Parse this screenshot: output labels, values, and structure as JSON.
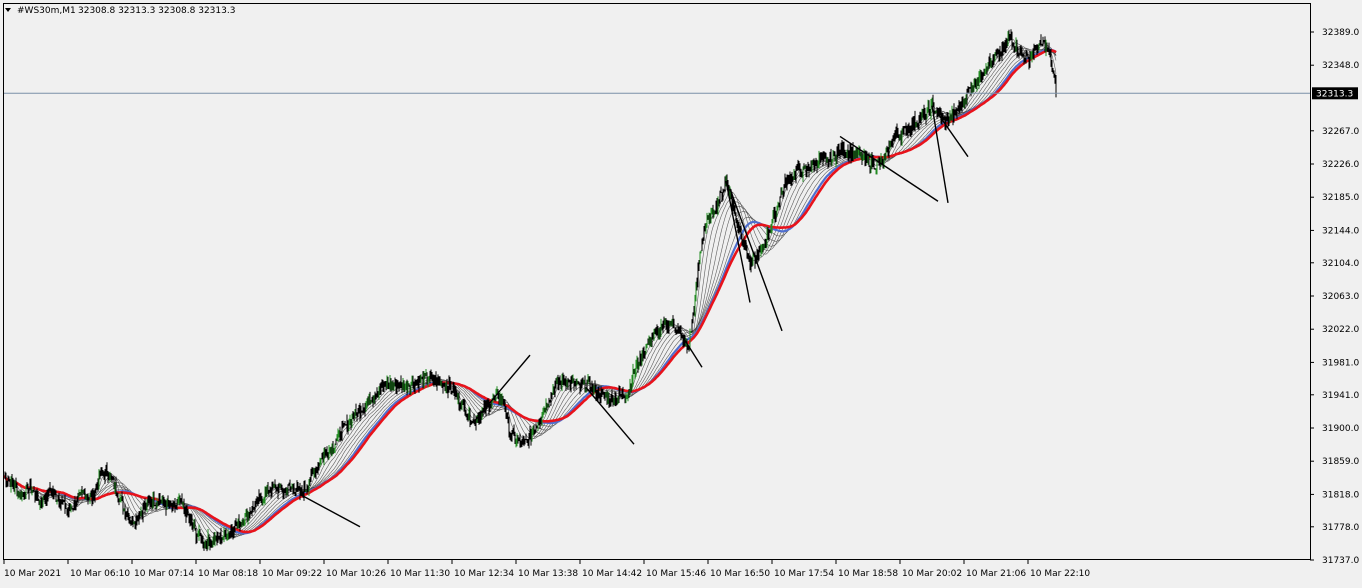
{
  "header": {
    "symbol": "#WS30m,M1",
    "ohlc": "32308.8 32313.3 32308.8 32313.3"
  },
  "colors": {
    "background": "#f0f0f0",
    "price": "#000000",
    "bull_candle": "#228b22",
    "ribbon": "#444444",
    "ma_blue": "#4f6fcf",
    "ma_red": "#e8131b",
    "price_line": "#7a90a8",
    "label_bg": "#000000",
    "label_text": "#ffffff"
  },
  "chart_data": {
    "type": "line",
    "title": "#WS30m,M1",
    "grid": false,
    "current_price": 32313.3,
    "current_price_label": "32313.3",
    "y_ticks": [
      "32389.0",
      "32348.0",
      "32307.0",
      "32267.0",
      "32226.0",
      "32185.0",
      "32144.0",
      "32104.0",
      "32063.0",
      "32022.0",
      "31981.0",
      "31941.0",
      "31900.0",
      "31859.0",
      "31818.0",
      "31778.0",
      "31737.0"
    ],
    "y_tick_values": [
      32389.0,
      32348.0,
      32307.0,
      32267.0,
      32226.0,
      32185.0,
      32144.0,
      32104.0,
      32063.0,
      32022.0,
      31981.0,
      31941.0,
      31900.0,
      31859.0,
      31818.0,
      31778.0,
      31737.0
    ],
    "ylim": [
      31737.0,
      32389.0
    ],
    "x_ticks": [
      "10 Mar 2021",
      "10 Mar 06:10",
      "10 Mar 07:14",
      "10 Mar 08:18",
      "10 Mar 09:22",
      "10 Mar 10:26",
      "10 Mar 11:30",
      "10 Mar 12:34",
      "10 Mar 13:38",
      "10 Mar 14:42",
      "10 Mar 15:46",
      "10 Mar 16:50",
      "10 Mar 17:54",
      "10 Mar 18:58",
      "10 Mar 20:02",
      "10 Mar 21:06",
      "10 Mar 22:10"
    ],
    "price_path": [
      [
        0,
        31840
      ],
      [
        8,
        31832
      ],
      [
        18,
        31815
      ],
      [
        26,
        31828
      ],
      [
        36,
        31808
      ],
      [
        46,
        31822
      ],
      [
        56,
        31812
      ],
      [
        64,
        31798
      ],
      [
        72,
        31808
      ],
      [
        80,
        31820
      ],
      [
        88,
        31812
      ],
      [
        96,
        31842
      ],
      [
        104,
        31845
      ],
      [
        112,
        31825
      ],
      [
        120,
        31800
      ],
      [
        128,
        31785
      ],
      [
        136,
        31795
      ],
      [
        146,
        31810
      ],
      [
        156,
        31812
      ],
      [
        166,
        31800
      ],
      [
        176,
        31808
      ],
      [
        184,
        31790
      ],
      [
        192,
        31770
      ],
      [
        200,
        31760
      ],
      [
        208,
        31762
      ],
      [
        216,
        31765
      ],
      [
        224,
        31770
      ],
      [
        232,
        31780
      ],
      [
        240,
        31790
      ],
      [
        248,
        31800
      ],
      [
        256,
        31812
      ],
      [
        264,
        31822
      ],
      [
        272,
        31826
      ],
      [
        280,
        31822
      ],
      [
        288,
        31828
      ],
      [
        296,
        31818
      ],
      [
        304,
        31830
      ],
      [
        312,
        31852
      ],
      [
        320,
        31868
      ],
      [
        328,
        31876
      ],
      [
        336,
        31894
      ],
      [
        344,
        31905
      ],
      [
        352,
        31918
      ],
      [
        360,
        31928
      ],
      [
        368,
        31938
      ],
      [
        376,
        31950
      ],
      [
        384,
        31954
      ],
      [
        392,
        31955
      ],
      [
        400,
        31952
      ],
      [
        408,
        31956
      ],
      [
        416,
        31958
      ],
      [
        424,
        31962
      ],
      [
        432,
        31958
      ],
      [
        440,
        31955
      ],
      [
        448,
        31948
      ],
      [
        456,
        31932
      ],
      [
        464,
        31918
      ],
      [
        470,
        31908
      ],
      [
        478,
        31918
      ],
      [
        486,
        31930
      ],
      [
        494,
        31940
      ],
      [
        500,
        31930
      ],
      [
        506,
        31895
      ],
      [
        512,
        31885
      ],
      [
        518,
        31880
      ],
      [
        524,
        31885
      ],
      [
        530,
        31898
      ],
      [
        536,
        31912
      ],
      [
        542,
        31928
      ],
      [
        548,
        31945
      ],
      [
        554,
        31955
      ],
      [
        560,
        31960
      ],
      [
        568,
        31955
      ],
      [
        576,
        31950
      ],
      [
        584,
        31955
      ],
      [
        592,
        31945
      ],
      [
        600,
        31938
      ],
      [
        608,
        31935
      ],
      [
        616,
        31940
      ],
      [
        624,
        31945
      ],
      [
        630,
        31970
      ],
      [
        636,
        31985
      ],
      [
        642,
        32000
      ],
      [
        648,
        32012
      ],
      [
        654,
        32018
      ],
      [
        660,
        32025
      ],
      [
        666,
        32030
      ],
      [
        672,
        32025
      ],
      [
        678,
        32010
      ],
      [
        684,
        31998
      ],
      [
        688,
        32030
      ],
      [
        692,
        32070
      ],
      [
        696,
        32115
      ],
      [
        700,
        32145
      ],
      [
        706,
        32160
      ],
      [
        712,
        32175
      ],
      [
        718,
        32190
      ],
      [
        722,
        32205
      ],
      [
        728,
        32180
      ],
      [
        734,
        32150
      ],
      [
        740,
        32130
      ],
      [
        746,
        32100
      ],
      [
        752,
        32110
      ],
      [
        758,
        32120
      ],
      [
        764,
        32140
      ],
      [
        770,
        32160
      ],
      [
        776,
        32185
      ],
      [
        782,
        32205
      ],
      [
        788,
        32210
      ],
      [
        794,
        32220
      ],
      [
        800,
        32215
      ],
      [
        808,
        32225
      ],
      [
        816,
        32230
      ],
      [
        822,
        32228
      ],
      [
        828,
        32232
      ],
      [
        834,
        32240
      ],
      [
        840,
        32245
      ],
      [
        848,
        32240
      ],
      [
        856,
        32235
      ],
      [
        864,
        32230
      ],
      [
        872,
        32225
      ],
      [
        880,
        32228
      ],
      [
        886,
        32250
      ],
      [
        892,
        32265
      ],
      [
        898,
        32262
      ],
      [
        904,
        32270
      ],
      [
        910,
        32278
      ],
      [
        916,
        32282
      ],
      [
        922,
        32288
      ],
      [
        928,
        32298
      ],
      [
        934,
        32288
      ],
      [
        940,
        32280
      ],
      [
        946,
        32282
      ],
      [
        952,
        32290
      ],
      [
        958,
        32300
      ],
      [
        964,
        32315
      ],
      [
        970,
        32325
      ],
      [
        976,
        32335
      ],
      [
        982,
        32348
      ],
      [
        988,
        32352
      ],
      [
        994,
        32360
      ],
      [
        1000,
        32368
      ],
      [
        1006,
        32385
      ],
      [
        1012,
        32370
      ],
      [
        1018,
        32360
      ],
      [
        1024,
        32355
      ],
      [
        1030,
        32365
      ],
      [
        1036,
        32372
      ],
      [
        1040,
        32375
      ],
      [
        1044,
        32365
      ],
      [
        1048,
        32345
      ],
      [
        1052,
        32315
      ]
    ],
    "ma_ribbon_offsets": [
      7,
      14,
      21,
      28,
      35,
      42,
      49
    ],
    "ma_red_lag": 60,
    "ma_blue_lag": 55,
    "trendlines": [
      [
        [
          296,
          31818
        ],
        [
          356,
          31778
        ]
      ],
      [
        [
          470,
          31908
        ],
        [
          526,
          31990
        ]
      ],
      [
        [
          582,
          31950
        ],
        [
          630,
          31880
        ]
      ],
      [
        [
          676,
          32018
        ],
        [
          698,
          31975
        ]
      ],
      [
        [
          722,
          32205
        ],
        [
          746,
          32055
        ]
      ],
      [
        [
          726,
          32195
        ],
        [
          778,
          32020
        ]
      ],
      [
        [
          836,
          32260
        ],
        [
          934,
          32180
        ]
      ],
      [
        [
          928,
          32298
        ],
        [
          944,
          32178
        ]
      ],
      [
        [
          934,
          32288
        ],
        [
          964,
          32235
        ]
      ]
    ]
  }
}
